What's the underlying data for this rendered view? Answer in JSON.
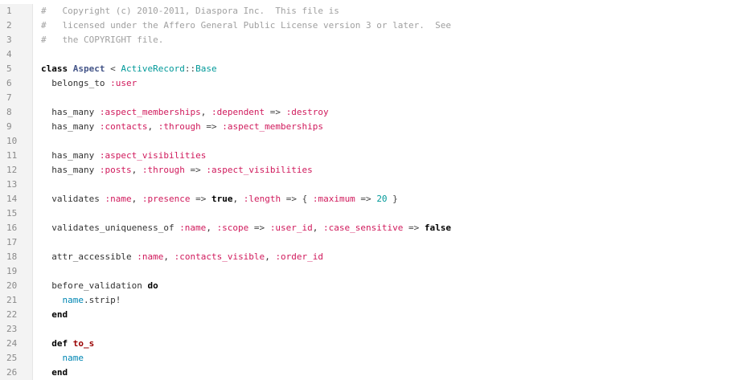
{
  "editor": {
    "lines": [
      {
        "num": "1",
        "tokens": [
          {
            "t": "#   Copyright (c) 2010-2011, Diaspora Inc.  This file is",
            "k": "comment"
          }
        ]
      },
      {
        "num": "2",
        "tokens": [
          {
            "t": "#   licensed under the Affero General Public License version 3 or later.  See",
            "k": "comment"
          }
        ]
      },
      {
        "num": "3",
        "tokens": [
          {
            "t": "#   the COPYRIGHT file.",
            "k": "comment"
          }
        ]
      },
      {
        "num": "4",
        "tokens": []
      },
      {
        "num": "5",
        "tokens": [
          {
            "t": "class",
            "k": "kw"
          },
          {
            "t": " ",
            "k": "plain"
          },
          {
            "t": "Aspect",
            "k": "class"
          },
          {
            "t": " < ",
            "k": "op"
          },
          {
            "t": "ActiveRecord",
            "k": "const"
          },
          {
            "t": "::",
            "k": "op"
          },
          {
            "t": "Base",
            "k": "const"
          }
        ]
      },
      {
        "num": "6",
        "tokens": [
          {
            "t": "  belongs_to ",
            "k": "plain"
          },
          {
            "t": ":user",
            "k": "sym"
          }
        ]
      },
      {
        "num": "7",
        "tokens": []
      },
      {
        "num": "8",
        "tokens": [
          {
            "t": "  has_many ",
            "k": "plain"
          },
          {
            "t": ":aspect_memberships",
            "k": "sym"
          },
          {
            "t": ", ",
            "k": "plain"
          },
          {
            "t": ":dependent",
            "k": "sym"
          },
          {
            "t": " => ",
            "k": "op"
          },
          {
            "t": ":destroy",
            "k": "sym"
          }
        ]
      },
      {
        "num": "9",
        "tokens": [
          {
            "t": "  has_many ",
            "k": "plain"
          },
          {
            "t": ":contacts",
            "k": "sym"
          },
          {
            "t": ", ",
            "k": "plain"
          },
          {
            "t": ":through",
            "k": "sym"
          },
          {
            "t": " => ",
            "k": "op"
          },
          {
            "t": ":aspect_memberships",
            "k": "sym"
          }
        ]
      },
      {
        "num": "10",
        "tokens": []
      },
      {
        "num": "11",
        "tokens": [
          {
            "t": "  has_many ",
            "k": "plain"
          },
          {
            "t": ":aspect_visibilities",
            "k": "sym"
          }
        ]
      },
      {
        "num": "12",
        "tokens": [
          {
            "t": "  has_many ",
            "k": "plain"
          },
          {
            "t": ":posts",
            "k": "sym"
          },
          {
            "t": ", ",
            "k": "plain"
          },
          {
            "t": ":through",
            "k": "sym"
          },
          {
            "t": " => ",
            "k": "op"
          },
          {
            "t": ":aspect_visibilities",
            "k": "sym"
          }
        ]
      },
      {
        "num": "13",
        "tokens": []
      },
      {
        "num": "14",
        "tokens": [
          {
            "t": "  validates ",
            "k": "plain"
          },
          {
            "t": ":name",
            "k": "sym"
          },
          {
            "t": ", ",
            "k": "plain"
          },
          {
            "t": ":presence",
            "k": "sym"
          },
          {
            "t": " => ",
            "k": "op"
          },
          {
            "t": "true",
            "k": "kw"
          },
          {
            "t": ", ",
            "k": "plain"
          },
          {
            "t": ":length",
            "k": "sym"
          },
          {
            "t": " => { ",
            "k": "op"
          },
          {
            "t": ":maximum",
            "k": "sym"
          },
          {
            "t": " => ",
            "k": "op"
          },
          {
            "t": "20",
            "k": "num"
          },
          {
            "t": " }",
            "k": "op"
          }
        ]
      },
      {
        "num": "15",
        "tokens": []
      },
      {
        "num": "16",
        "tokens": [
          {
            "t": "  validates_uniqueness_of ",
            "k": "plain"
          },
          {
            "t": ":name",
            "k": "sym"
          },
          {
            "t": ", ",
            "k": "plain"
          },
          {
            "t": ":scope",
            "k": "sym"
          },
          {
            "t": " => ",
            "k": "op"
          },
          {
            "t": ":user_id",
            "k": "sym"
          },
          {
            "t": ", ",
            "k": "plain"
          },
          {
            "t": ":case_sensitive",
            "k": "sym"
          },
          {
            "t": " => ",
            "k": "op"
          },
          {
            "t": "false",
            "k": "kw"
          }
        ]
      },
      {
        "num": "17",
        "tokens": []
      },
      {
        "num": "18",
        "tokens": [
          {
            "t": "  attr_accessible ",
            "k": "plain"
          },
          {
            "t": ":name",
            "k": "sym"
          },
          {
            "t": ", ",
            "k": "plain"
          },
          {
            "t": ":contacts_visible",
            "k": "sym"
          },
          {
            "t": ", ",
            "k": "plain"
          },
          {
            "t": ":order_id",
            "k": "sym"
          }
        ]
      },
      {
        "num": "19",
        "tokens": []
      },
      {
        "num": "20",
        "tokens": [
          {
            "t": "  before_validation ",
            "k": "plain"
          },
          {
            "t": "do",
            "k": "kw"
          }
        ]
      },
      {
        "num": "21",
        "tokens": [
          {
            "t": "    ",
            "k": "plain"
          },
          {
            "t": "name",
            "k": "ident"
          },
          {
            "t": ".strip!",
            "k": "plain"
          }
        ]
      },
      {
        "num": "22",
        "tokens": [
          {
            "t": "  ",
            "k": "plain"
          },
          {
            "t": "end",
            "k": "kw"
          }
        ]
      },
      {
        "num": "23",
        "tokens": []
      },
      {
        "num": "24",
        "tokens": [
          {
            "t": "  ",
            "k": "plain"
          },
          {
            "t": "def",
            "k": "kw"
          },
          {
            "t": " ",
            "k": "plain"
          },
          {
            "t": "to_s",
            "k": "method"
          }
        ]
      },
      {
        "num": "25",
        "tokens": [
          {
            "t": "    ",
            "k": "plain"
          },
          {
            "t": "name",
            "k": "ident"
          }
        ]
      },
      {
        "num": "26",
        "tokens": [
          {
            "t": "  ",
            "k": "plain"
          },
          {
            "t": "end",
            "k": "kw"
          }
        ]
      }
    ]
  }
}
